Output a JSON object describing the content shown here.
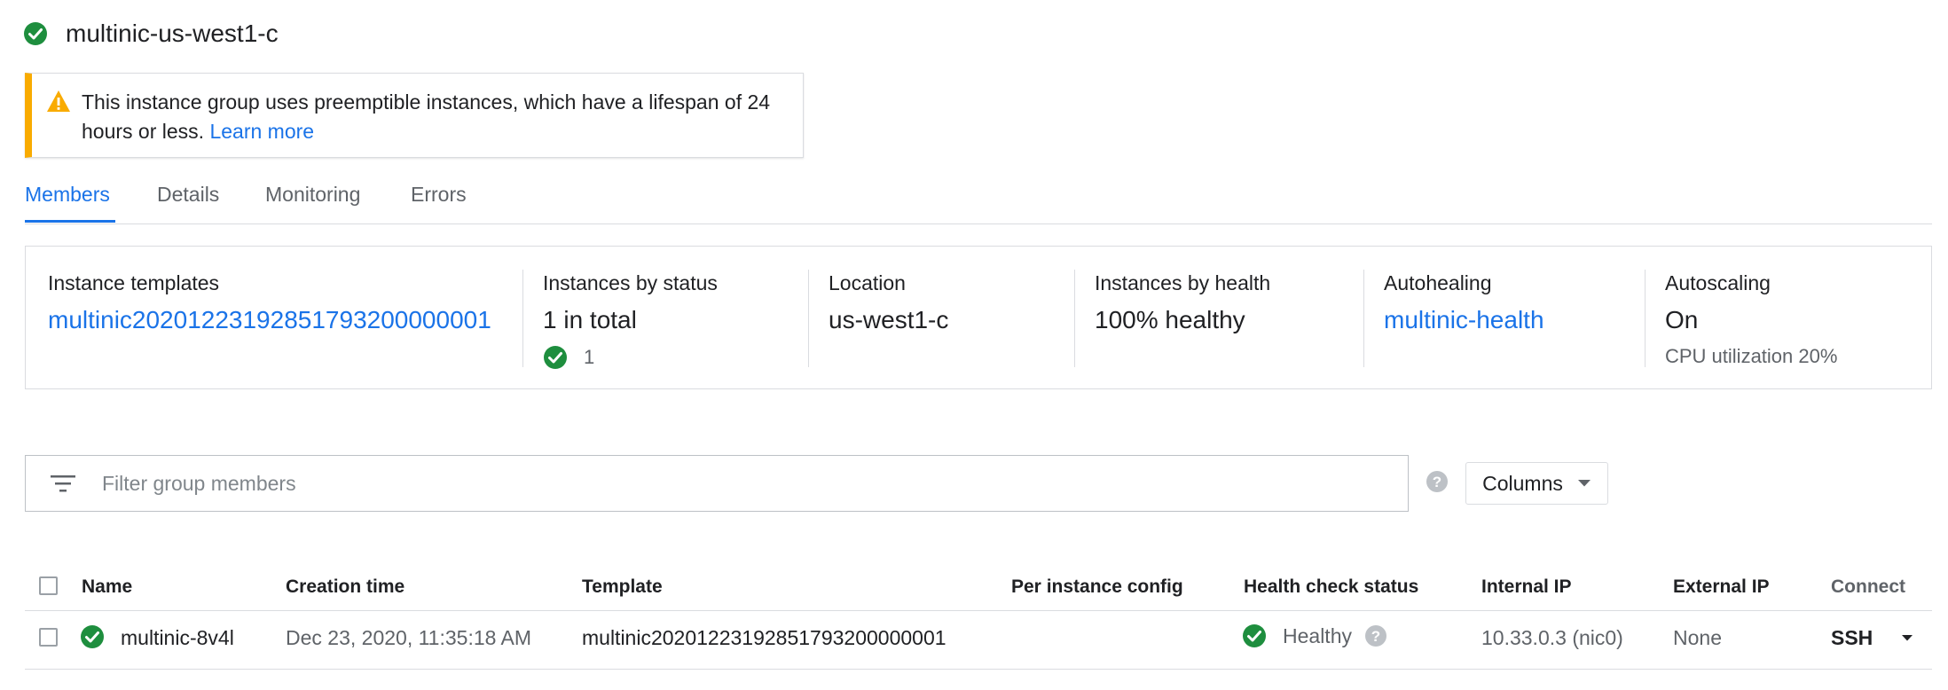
{
  "header": {
    "title": "multinic-us-west1-c",
    "status_icon": "check-circle-icon"
  },
  "banner": {
    "text": "This instance group uses preemptible instances, which have a lifespan of 24 hours or less.",
    "link": "Learn more",
    "icon": "warning-icon",
    "accent_color": "#f9ab00"
  },
  "tabs": [
    {
      "label": "Members",
      "active": true
    },
    {
      "label": "Details",
      "active": false
    },
    {
      "label": "Monitoring",
      "active": false
    },
    {
      "label": "Errors",
      "active": false
    }
  ],
  "summary": {
    "templates": {
      "label": "Instance templates",
      "value": "multinic20201223192851793200000001"
    },
    "status": {
      "label": "Instances by status",
      "value": "1 in total",
      "running_count": "1"
    },
    "location": {
      "label": "Location",
      "value": "us-west1-c"
    },
    "health": {
      "label": "Instances by health",
      "value": "100% healthy"
    },
    "autohealing": {
      "label": "Autohealing",
      "value": "multinic-health"
    },
    "autoscaling": {
      "label": "Autoscaling",
      "value": "On",
      "sub": "CPU utilization 20%"
    }
  },
  "filter": {
    "placeholder": "Filter group members",
    "icon": "filter-icon"
  },
  "columns_button": {
    "label": "Columns"
  },
  "table": {
    "columns": [
      "Name",
      "Creation time",
      "Template",
      "Per instance config",
      "Health check status",
      "Internal IP",
      "External IP",
      "Connect"
    ],
    "rows": [
      {
        "name": "multinic-8v4l",
        "creation_time": "Dec 23, 2020, 11:35:18 AM",
        "template": "multinic20201223192851793200000001",
        "per_instance_config": "",
        "health": "Healthy",
        "internal_ip": "10.33.0.3",
        "internal_ip_nic": "(nic0)",
        "external_ip": "None",
        "connect": "SSH"
      }
    ]
  },
  "colors": {
    "accent": "#1a73e8",
    "success": "#1e8e3e",
    "warning": "#f9ab00",
    "border": "#dadce0"
  }
}
